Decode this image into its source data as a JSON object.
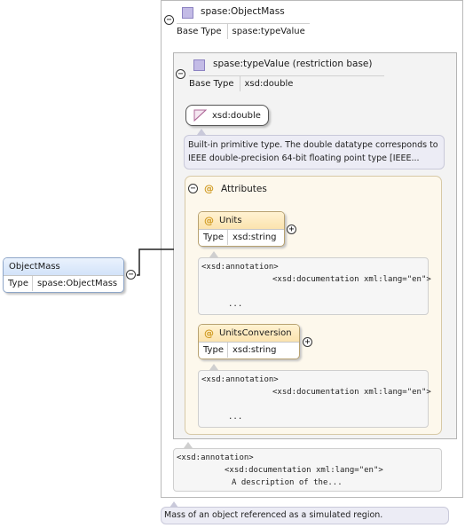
{
  "element": {
    "name": "ObjectMass",
    "type_key": "Type",
    "type_value": "spase:ObjectMass"
  },
  "complex_type": {
    "title": "spase:ObjectMass",
    "base_key": "Base Type",
    "base_value": "spase:typeValue"
  },
  "restriction": {
    "title": "spase:typeValue (restriction base)",
    "base_key": "Base Type",
    "base_value": "xsd:double"
  },
  "primitive": {
    "name": "xsd:double",
    "description_line1": "Built-in primitive type. The double datatype corresponds to",
    "description_line2": "IEEE double-precision 64-bit floating point type [IEEE..."
  },
  "attributes": {
    "title": "Attributes",
    "items": [
      {
        "name": "Units",
        "type_key": "Type",
        "type_value": "xsd:string",
        "annotation_tag": "<xsd:annotation>",
        "documentation_tag": "<xsd:documentation xml:lang=\"en\">",
        "ellipsis": "..."
      },
      {
        "name": "UnitsConversion",
        "type_key": "Type",
        "type_value": "xsd:string",
        "annotation_tag": "<xsd:annotation>",
        "documentation_tag": "<xsd:documentation xml:lang=\"en\">",
        "ellipsis": "..."
      }
    ]
  },
  "type_annotation": {
    "annotation_tag": "<xsd:annotation>",
    "documentation_tag": "<xsd:documentation xml:lang=\"en\">",
    "text": "A description of the..."
  },
  "element_description": "Mass of an object referenced as a simulated region.",
  "icons": {
    "collapse": "minus-circle",
    "expand": "plus-circle",
    "complex": "lavender-square",
    "attribute": "at-sign"
  },
  "colors": {
    "element_header": "#d9e7fb",
    "attribute_header": "#fbe3ae",
    "attributes_panel": "#fdf8ec",
    "description_bg": "#ececf5"
  }
}
